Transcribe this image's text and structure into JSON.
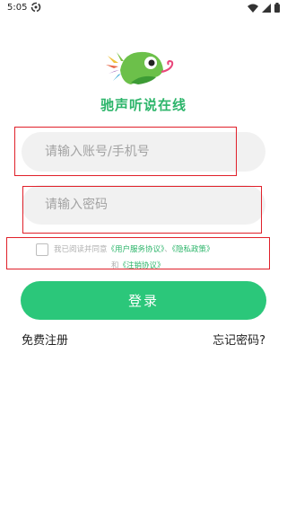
{
  "status_bar": {
    "time": "5:05"
  },
  "app": {
    "name": "驰声听说在线"
  },
  "login_form": {
    "account_placeholder": "请输入账号/手机号",
    "password_placeholder": "请输入密码",
    "agreement": {
      "prefix": "我已阅读并同意",
      "user_agreement": "《用户服务协议》",
      "separator": "、",
      "privacy_policy": "《隐私政策》",
      "and": "和",
      "cancel_agreement": "《注销协议》"
    },
    "login_button": "登录",
    "register_link": "免费注册",
    "forgot_link": "忘记密码?"
  },
  "colors": {
    "accent": "#2bc77a",
    "link_green": "#2cb56a",
    "annotation_red": "#e0202a"
  }
}
